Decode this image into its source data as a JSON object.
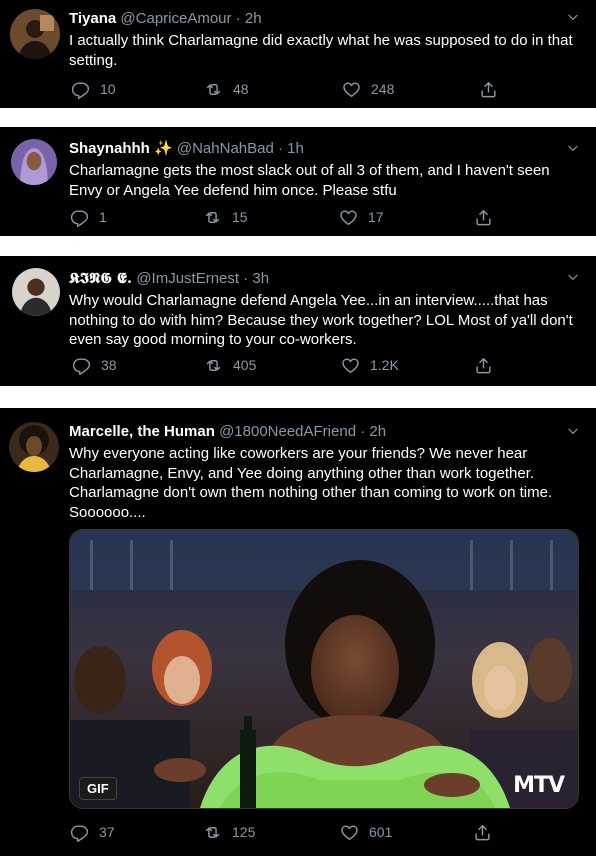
{
  "tweets": [
    {
      "name": "Tiyana",
      "handle": "@CapriceAmour",
      "time": "2h",
      "text": "I actually think Charlamagne did exactly what he was supposed to do in that setting.",
      "replies": "10",
      "retweets": "48",
      "likes": "248"
    },
    {
      "name": "Shaynahhh ✨",
      "handle": "@NahNahBad",
      "time": "1h",
      "text": "Charlamagne gets the most slack out of all 3 of them, and I haven't seen Envy or Angela Yee defend him once. Please stfu",
      "replies": "1",
      "retweets": "15",
      "likes": "17"
    },
    {
      "name": "𝕶𝕴𝕹𝕲 𝕰.",
      "handle": "@ImJustErnest",
      "time": "3h",
      "text": "Why would Charlamagne defend Angela Yee...in an interview.....that has nothing to do with him? Because they work together? LOL Most of ya'll don't even say good morning to your co-workers.",
      "replies": "38",
      "retweets": "405",
      "likes": "1.2K"
    },
    {
      "name": "Marcelle, the Human",
      "handle": "@1800NeedAFriend",
      "time": "2h",
      "text": "Why everyone acting like coworkers are your friends? We never hear Charlamagne, Envy, and Yee doing anything other than work together. Charlamagne don't own them nothing other than coming to work on time. Soooooo....",
      "replies": "37",
      "retweets": "125",
      "likes": "601",
      "media": {
        "badge": "GIF",
        "watermark": "MTV"
      }
    }
  ],
  "dot": "·",
  "icons": {
    "reply": "reply-icon",
    "retweet": "retweet-icon",
    "like": "heart-icon",
    "share": "share-icon",
    "more": "chevron-down-icon"
  },
  "colors": {
    "background": "#000000",
    "secondary_text": "#8899a6",
    "primary_text": "#ffffff"
  }
}
